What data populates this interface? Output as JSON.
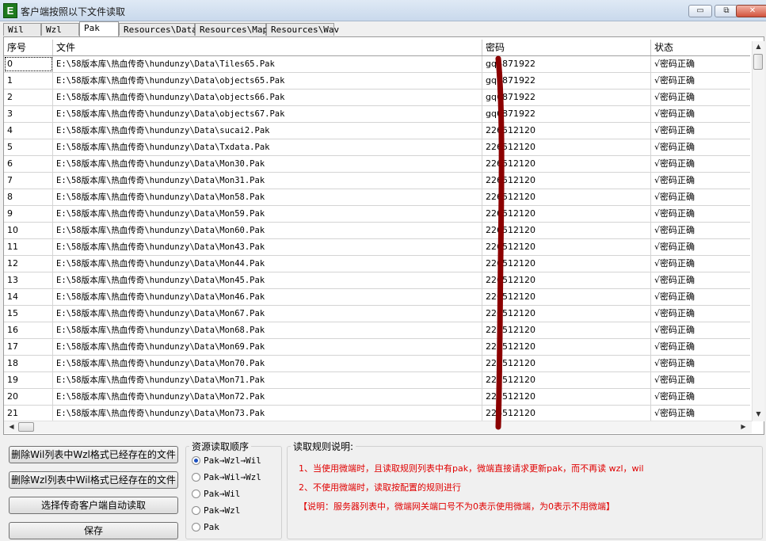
{
  "window": {
    "title": "客户端按照以下文件读取",
    "icon_letter": "E",
    "minimize": "▭",
    "restore": "⧉",
    "close": "✕"
  },
  "tabs": [
    "Wil",
    "Wzl",
    "Pak",
    "Resources\\Data",
    "Resources\\Map",
    "Resources\\Wav"
  ],
  "active_tab": "Pak",
  "table": {
    "columns": [
      "序号",
      "文件",
      "密码",
      "状态"
    ],
    "rows": [
      {
        "idx": "0",
        "file": "E:\\58版本库\\热血传奇\\hundunzy\\Data\\Tiles65.Pak",
        "pwd": "gq6871922",
        "status": "√密码正确"
      },
      {
        "idx": "1",
        "file": "E:\\58版本库\\热血传奇\\hundunzy\\Data\\objects65.Pak",
        "pwd": "gq6871922",
        "status": "√密码正确"
      },
      {
        "idx": "2",
        "file": "E:\\58版本库\\热血传奇\\hundunzy\\Data\\objects66.Pak",
        "pwd": "gq6871922",
        "status": "√密码正确"
      },
      {
        "idx": "3",
        "file": "E:\\58版本库\\热血传奇\\hundunzy\\Data\\objects67.Pak",
        "pwd": "gq6871922",
        "status": "√密码正确"
      },
      {
        "idx": "4",
        "file": "E:\\58版本库\\热血传奇\\hundunzy\\Data\\sucai2.Pak",
        "pwd": "226512120",
        "status": "√密码正确"
      },
      {
        "idx": "5",
        "file": "E:\\58版本库\\热血传奇\\hundunzy\\Data\\Txdata.Pak",
        "pwd": "226512120",
        "status": "√密码正确"
      },
      {
        "idx": "6",
        "file": "E:\\58版本库\\热血传奇\\hundunzy\\Data\\Mon30.Pak",
        "pwd": "226512120",
        "status": "√密码正确"
      },
      {
        "idx": "7",
        "file": "E:\\58版本库\\热血传奇\\hundunzy\\Data\\Mon31.Pak",
        "pwd": "226512120",
        "status": "√密码正确"
      },
      {
        "idx": "8",
        "file": "E:\\58版本库\\热血传奇\\hundunzy\\Data\\Mon58.Pak",
        "pwd": "226512120",
        "status": "√密码正确"
      },
      {
        "idx": "9",
        "file": "E:\\58版本库\\热血传奇\\hundunzy\\Data\\Mon59.Pak",
        "pwd": "226512120",
        "status": "√密码正确"
      },
      {
        "idx": "10",
        "file": "E:\\58版本库\\热血传奇\\hundunzy\\Data\\Mon60.Pak",
        "pwd": "226512120",
        "status": "√密码正确"
      },
      {
        "idx": "11",
        "file": "E:\\58版本库\\热血传奇\\hundunzy\\Data\\Mon43.Pak",
        "pwd": "226512120",
        "status": "√密码正确"
      },
      {
        "idx": "12",
        "file": "E:\\58版本库\\热血传奇\\hundunzy\\Data\\Mon44.Pak",
        "pwd": "226512120",
        "status": "√密码正确"
      },
      {
        "idx": "13",
        "file": "E:\\58版本库\\热血传奇\\hundunzy\\Data\\Mon45.Pak",
        "pwd": "226512120",
        "status": "√密码正确"
      },
      {
        "idx": "14",
        "file": "E:\\58版本库\\热血传奇\\hundunzy\\Data\\Mon46.Pak",
        "pwd": "226512120",
        "status": "√密码正确"
      },
      {
        "idx": "15",
        "file": "E:\\58版本库\\热血传奇\\hundunzy\\Data\\Mon67.Pak",
        "pwd": "226512120",
        "status": "√密码正确"
      },
      {
        "idx": "16",
        "file": "E:\\58版本库\\热血传奇\\hundunzy\\Data\\Mon68.Pak",
        "pwd": "226512120",
        "status": "√密码正确"
      },
      {
        "idx": "17",
        "file": "E:\\58版本库\\热血传奇\\hundunzy\\Data\\Mon69.Pak",
        "pwd": "226512120",
        "status": "√密码正确"
      },
      {
        "idx": "18",
        "file": "E:\\58版本库\\热血传奇\\hundunzy\\Data\\Mon70.Pak",
        "pwd": "226512120",
        "status": "√密码正确"
      },
      {
        "idx": "19",
        "file": "E:\\58版本库\\热血传奇\\hundunzy\\Data\\Mon71.Pak",
        "pwd": "226512120",
        "status": "√密码正确"
      },
      {
        "idx": "20",
        "file": "E:\\58版本库\\热血传奇\\hundunzy\\Data\\Mon72.Pak",
        "pwd": "226512120",
        "status": "√密码正确"
      },
      {
        "idx": "21",
        "file": "E:\\58版本库\\热血传奇\\hundunzy\\Data\\Mon73.Pak",
        "pwd": "226512120",
        "status": "√密码正确"
      }
    ]
  },
  "buttons": {
    "delete_wil": "删除Wil列表中Wzl格式已经存在的文件",
    "delete_wzl": "删除Wzl列表中Wil格式已经存在的文件",
    "choose_client": "选择传奇客户端自动读取",
    "save": "保存"
  },
  "order": {
    "title": "资源读取顺序",
    "options": [
      "Pak→Wzl→Wil",
      "Pak→Wil→Wzl",
      "Pak→Wil",
      "Pak→Wzl",
      "Pak"
    ],
    "selected_index": 0
  },
  "rules": {
    "title": "读取规则说明:",
    "line1": "1、当使用微端时，且读取规则列表中有pak，微端直接请求更新pak，而不再读 wzl，wil",
    "line2": "2、不使用微端时，读取按配置的规则进行",
    "line3": "【说明：服务器列表中，微端网关端口号不为0表示使用微端，为0表示不用微端】",
    "color": "#e00000"
  },
  "colors": {
    "annotation_stroke": "#8b0000"
  }
}
